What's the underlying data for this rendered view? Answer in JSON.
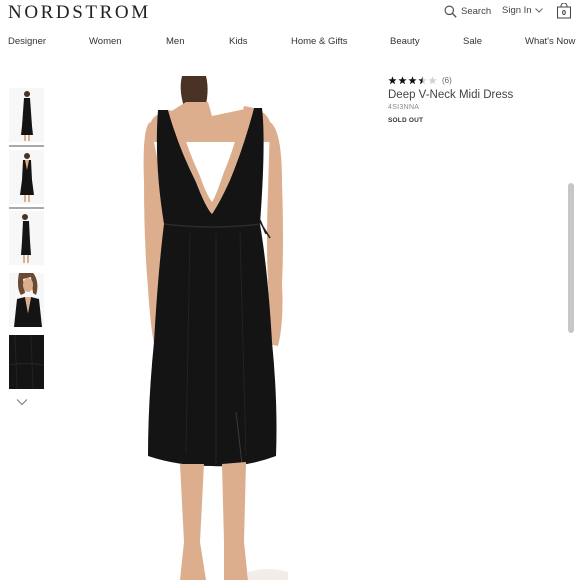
{
  "header": {
    "brand": "NORDSTROM",
    "search_label": "Search",
    "sign_in_label": "Sign In",
    "bag_count": "0",
    "icons": {
      "search": "search-icon",
      "sign_in_menu": "chevron-down-icon",
      "bag": "shopping-bag-icon"
    }
  },
  "nav": {
    "items": [
      {
        "label": "Designer"
      },
      {
        "label": "Women"
      },
      {
        "label": "Men"
      },
      {
        "label": "Kids"
      },
      {
        "label": "Home & Gifts"
      },
      {
        "label": "Beauty"
      },
      {
        "label": "Sale"
      },
      {
        "label": "What's Now"
      }
    ]
  },
  "gallery": {
    "thumbnail_count": 5,
    "selected_index": 2,
    "more_icon": "chevron-down-icon"
  },
  "product": {
    "rating": 3.5,
    "rating_max": 5,
    "review_count": "(6)",
    "title": "Deep V-Neck Midi Dress",
    "style_number": "4SI3NNA",
    "availability": "SOLD OUT"
  },
  "colors": {
    "dress": "#141414",
    "skin": "#dcae8e",
    "hair": "#4a3224",
    "star": "#111111",
    "star_empty": "#d0d0d0",
    "scrollbar": "#c7c7c7"
  }
}
